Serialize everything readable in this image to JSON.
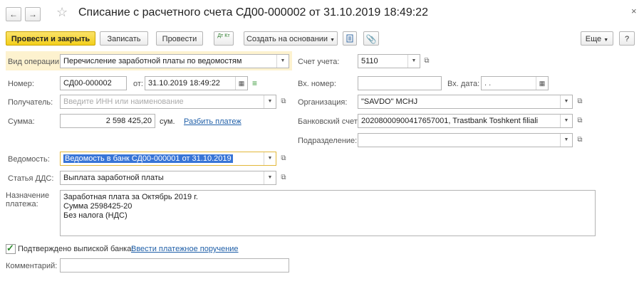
{
  "header": {
    "title": "Списание с расчетного счета СД00-000002 от 31.10.2019 18:49:22",
    "back_icon": "←",
    "forward_icon": "→",
    "favorite_icon": "☆",
    "close_icon": "×"
  },
  "toolbar": {
    "post_close": "Провести и закрыть",
    "save": "Записать",
    "post": "Провести",
    "dtkt": "Дт Кт",
    "create_based": "Создать на основании",
    "more": "Еще",
    "help": "?"
  },
  "form": {
    "operation_label": "Вид операции:",
    "operation_value": "Перечисление заработной платы по ведомостям",
    "number_label": "Номер:",
    "number_value": "СД00-000002",
    "from_label": "от:",
    "date_value": "31.10.2019 18:49:22",
    "recipient_label": "Получатель:",
    "recipient_placeholder": "Введите ИНН или наименование",
    "sum_label": "Сумма:",
    "sum_value": "2 598 425,20",
    "currency": "сум.",
    "split_link": "Разбить платеж",
    "statement_label": "Ведомость:",
    "statement_value": "Ведомость в банк СД00-000001 от 31.10.2019",
    "dds_label": "Статья ДДС:",
    "dds_value": "Выплата заработной платы",
    "purpose_label_1": "Назначение",
    "purpose_label_2": "платежа:",
    "purpose_value": "Заработная плата за Октябрь 2019 г.\nСумма 2598425-20\nБез налога (НДС)",
    "confirmed_label": "Подтверждено выпиской банка:",
    "enter_order_link": "Ввести платежное поручение",
    "comment_label": "Комментарий:",
    "comment_value": "",
    "account_label": "Счет учета:",
    "account_value": "5110",
    "in_number_label": "Вх. номер:",
    "in_number_value": "",
    "in_date_label": "Вх. дата:",
    "in_date_value": " .  .",
    "org_label": "Организация:",
    "org_value": "\"SAVDO\" MCHJ",
    "bank_label": "Банковский счет:",
    "bank_value": "20208000900417657001, Trastbank Toshkent filiali",
    "dept_label": "Подразделение:",
    "dept_value": ""
  }
}
